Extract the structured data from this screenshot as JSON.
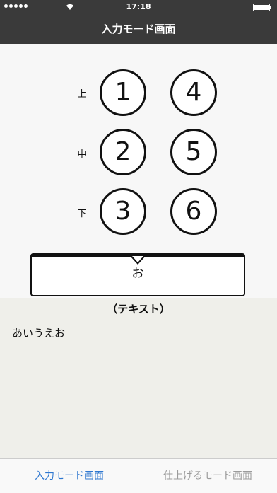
{
  "status_bar": {
    "time": "17:18"
  },
  "nav": {
    "title": "入力モード画面"
  },
  "keypad": {
    "row_labels": [
      "上",
      "中",
      "下"
    ],
    "keys": [
      "1",
      "2",
      "3",
      "4",
      "5",
      "6"
    ]
  },
  "output": {
    "char": "お"
  },
  "text_area": {
    "title": "（テキスト）",
    "content": "あいうえお"
  },
  "tabs": [
    {
      "label": "入力モード画面",
      "active": true
    },
    {
      "label": "仕上げるモード画面",
      "active": false
    }
  ],
  "colors": {
    "bar": "#3a3a3a",
    "active_tab": "#2e77d0",
    "inactive_tab": "#9b9b9b"
  }
}
